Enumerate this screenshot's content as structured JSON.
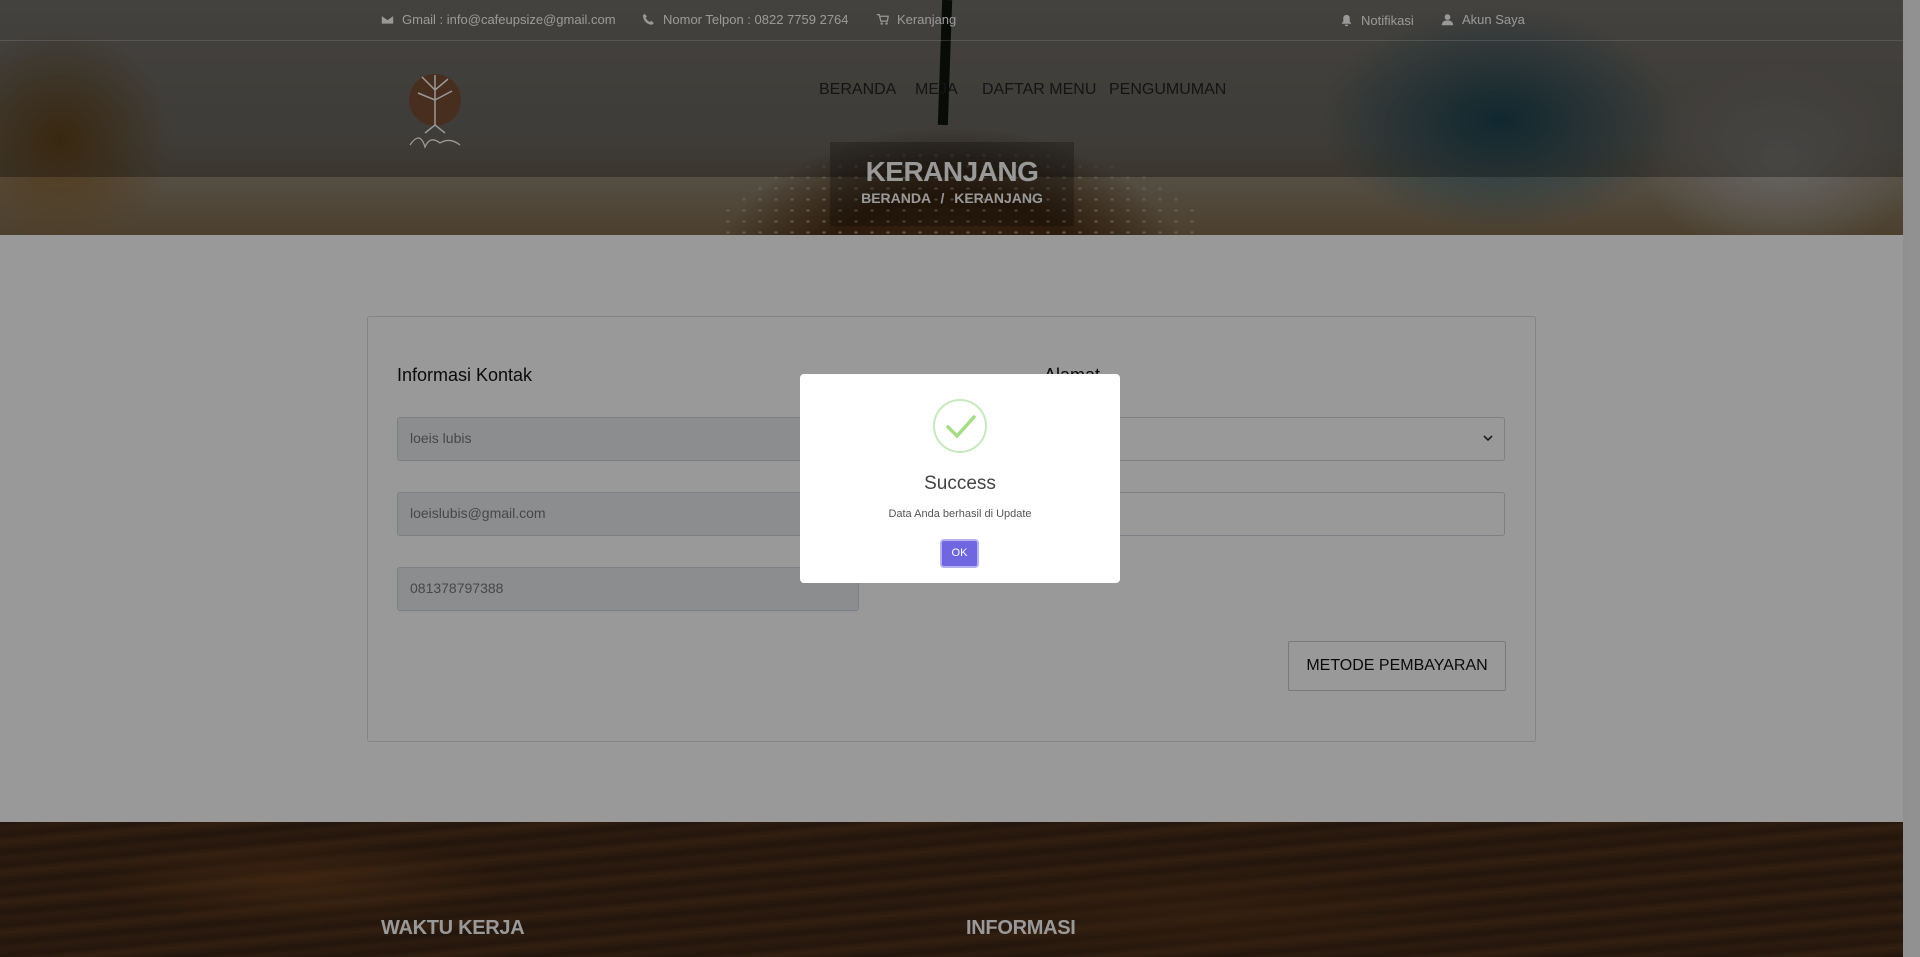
{
  "topbar": {
    "email": "Gmail : info@cafeupsize@gmail.com",
    "phone": "Nomor Telpon : 0822 7759 2764",
    "cart": "Keranjang",
    "notifications": "Notifikasi",
    "account": "Akun Saya"
  },
  "nav": {
    "items": [
      "BERANDA",
      "MEJA",
      "DAFTAR MENU",
      "PENGUMUMAN"
    ]
  },
  "hero": {
    "title": "KERANJANG",
    "breadcrumb_home": "BERANDA",
    "breadcrumb_sep": "/",
    "breadcrumb_current": "KERANJANG"
  },
  "contact": {
    "title": "Informasi Kontak",
    "name_value": "loeis lubis",
    "email_value": "loeislubis@gmail.com",
    "phone_value": "081378797388"
  },
  "address": {
    "title": "Alamat"
  },
  "payment_button": "METODE PEMBAYARAN",
  "footer": {
    "col1_title": "WAKTU KERJA",
    "col2_title": "INFORMASI"
  },
  "modal": {
    "title": "Success",
    "message": "Data Anda berhasil di Update",
    "ok_label": "OK"
  },
  "colors": {
    "ok_button": "#7066e0",
    "success_check": "#a5dc86"
  }
}
